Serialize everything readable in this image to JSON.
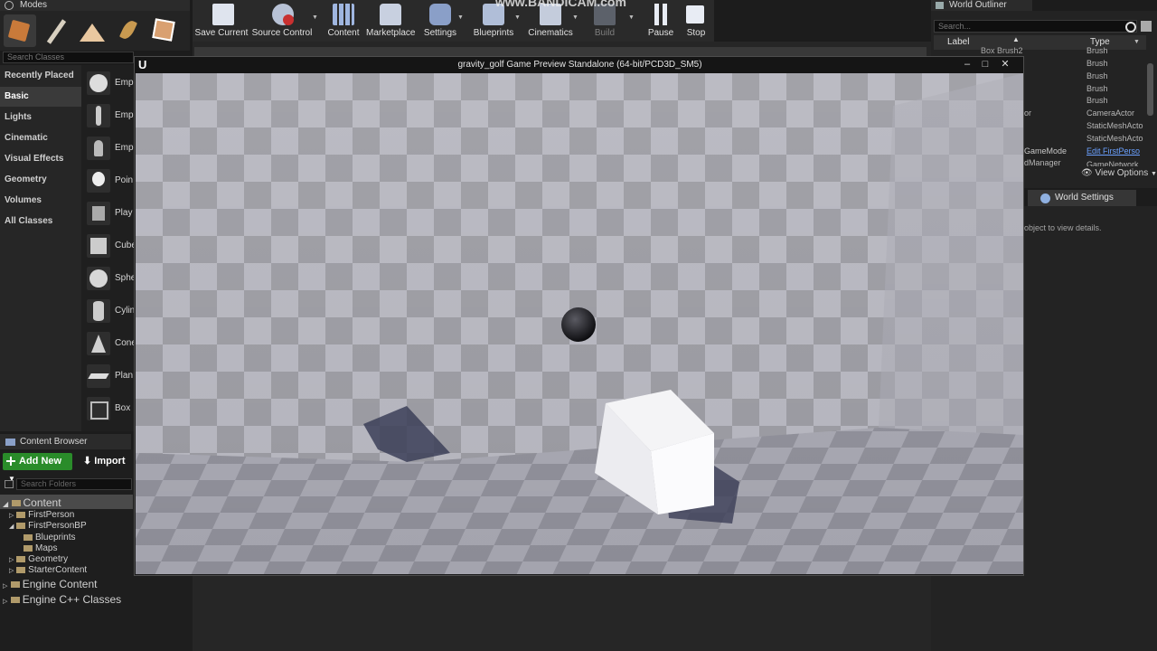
{
  "modes": {
    "tab_label": "Modes",
    "search_placeholder": "Search Classes"
  },
  "categories": [
    "Recently Placed",
    "Basic",
    "Lights",
    "Cinematic",
    "Visual Effects",
    "Geometry",
    "Volumes",
    "All Classes"
  ],
  "placeables": [
    "Emp",
    "Emp",
    "Emp",
    "Poin",
    "Play",
    "Cube",
    "Sphe",
    "Cylin",
    "Cone",
    "Plan",
    "Box"
  ],
  "toolbar": {
    "items": [
      "Save Current",
      "Source Control",
      "Content",
      "Marketplace",
      "Settings",
      "Blueprints",
      "Cinematics",
      "Build",
      "Pause",
      "Stop"
    ],
    "watermark": "www.BANDICAM.com"
  },
  "content_browser": {
    "tab_label": "Content Browser",
    "add_new": "Add New",
    "import": "Import",
    "search_placeholder": "Search Folders",
    "tree": {
      "content": "Content",
      "first_person": "FirstPerson",
      "first_person_bp": "FirstPersonBP",
      "blueprints": "Blueprints",
      "maps": "Maps",
      "geometry": "Geometry",
      "starter_content": "StarterContent",
      "engine_content": "Engine Content",
      "engine_cpp": "Engine C++ Classes"
    }
  },
  "world_outliner": {
    "tab_label": "World Outliner",
    "search_placeholder": "Search...",
    "col_label": "Label",
    "col_type": "Type",
    "partial_labels": [
      "Box Brush2",
      "or",
      "GameMode",
      "dManager"
    ],
    "types": [
      "Brush",
      "Brush",
      "Brush",
      "Brush",
      "Brush",
      "CameraActor",
      "StaticMeshActo",
      "StaticMeshActo",
      "Edit FirstPerso",
      "GameNetwork"
    ],
    "view_options": "View Options"
  },
  "details": {
    "tab_label": "World Settings",
    "hint": "object to view details."
  },
  "game_window": {
    "title": "gravity_golf Game Preview Standalone (64-bit/PCD3D_SM5)",
    "logo": "U"
  },
  "colors": {
    "add_new_green": "#2a8c2a",
    "link_blue": "#6aa0ff",
    "wall_light": "#b5b5bd",
    "wall_dark": "#8f8f98"
  }
}
